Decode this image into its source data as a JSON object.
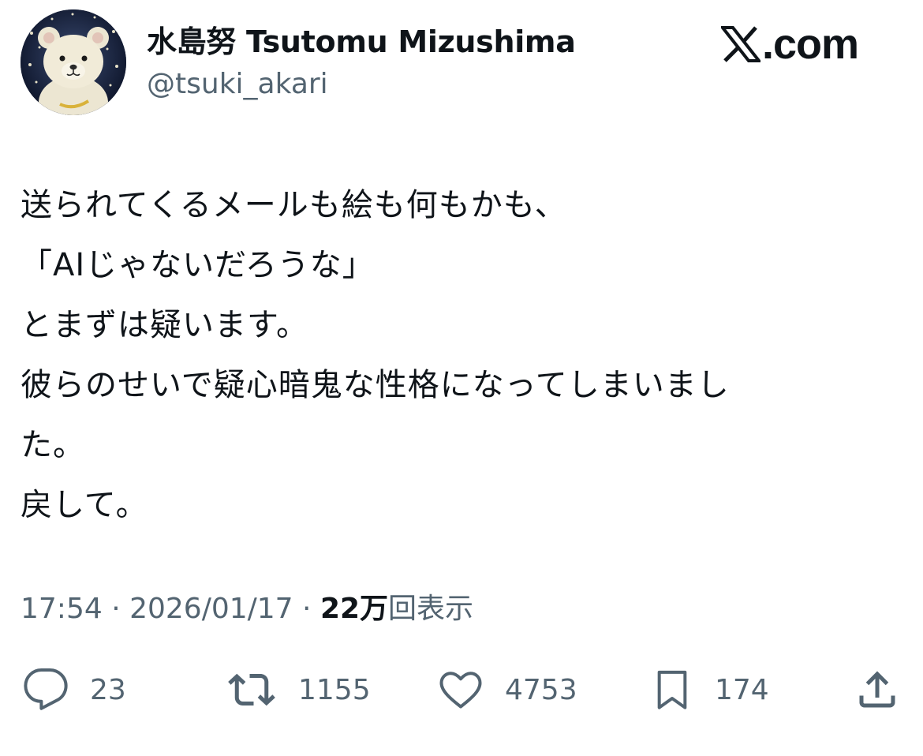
{
  "author": {
    "display_name": "水島努 Tsutomu Mizushima",
    "handle": "@tsuki_akari"
  },
  "brand": {
    "logo_text": ".com",
    "icon": "x-logo-icon"
  },
  "tweet": {
    "lines": [
      "送られてくるメールも絵も何もかも、",
      "「AIじゃないだろうな」",
      "とまずは疑います。",
      "彼らのせいで疑心暗鬼な性格になってしまいまし",
      "た。",
      "戻して。"
    ],
    "time": "17:54",
    "separator": "·",
    "date": "2026/01/17",
    "views_count": "22万",
    "views_label": "回表示"
  },
  "actions": {
    "reply": {
      "icon": "reply-icon",
      "count": "23"
    },
    "retweet": {
      "icon": "retweet-icon",
      "count": "1155"
    },
    "like": {
      "icon": "heart-icon",
      "count": "4753"
    },
    "bookmark": {
      "icon": "bookmark-icon",
      "count": "174"
    },
    "share": {
      "icon": "share-icon"
    }
  },
  "colors": {
    "text_primary": "#0f1419",
    "text_secondary": "#536471",
    "background": "#ffffff"
  }
}
